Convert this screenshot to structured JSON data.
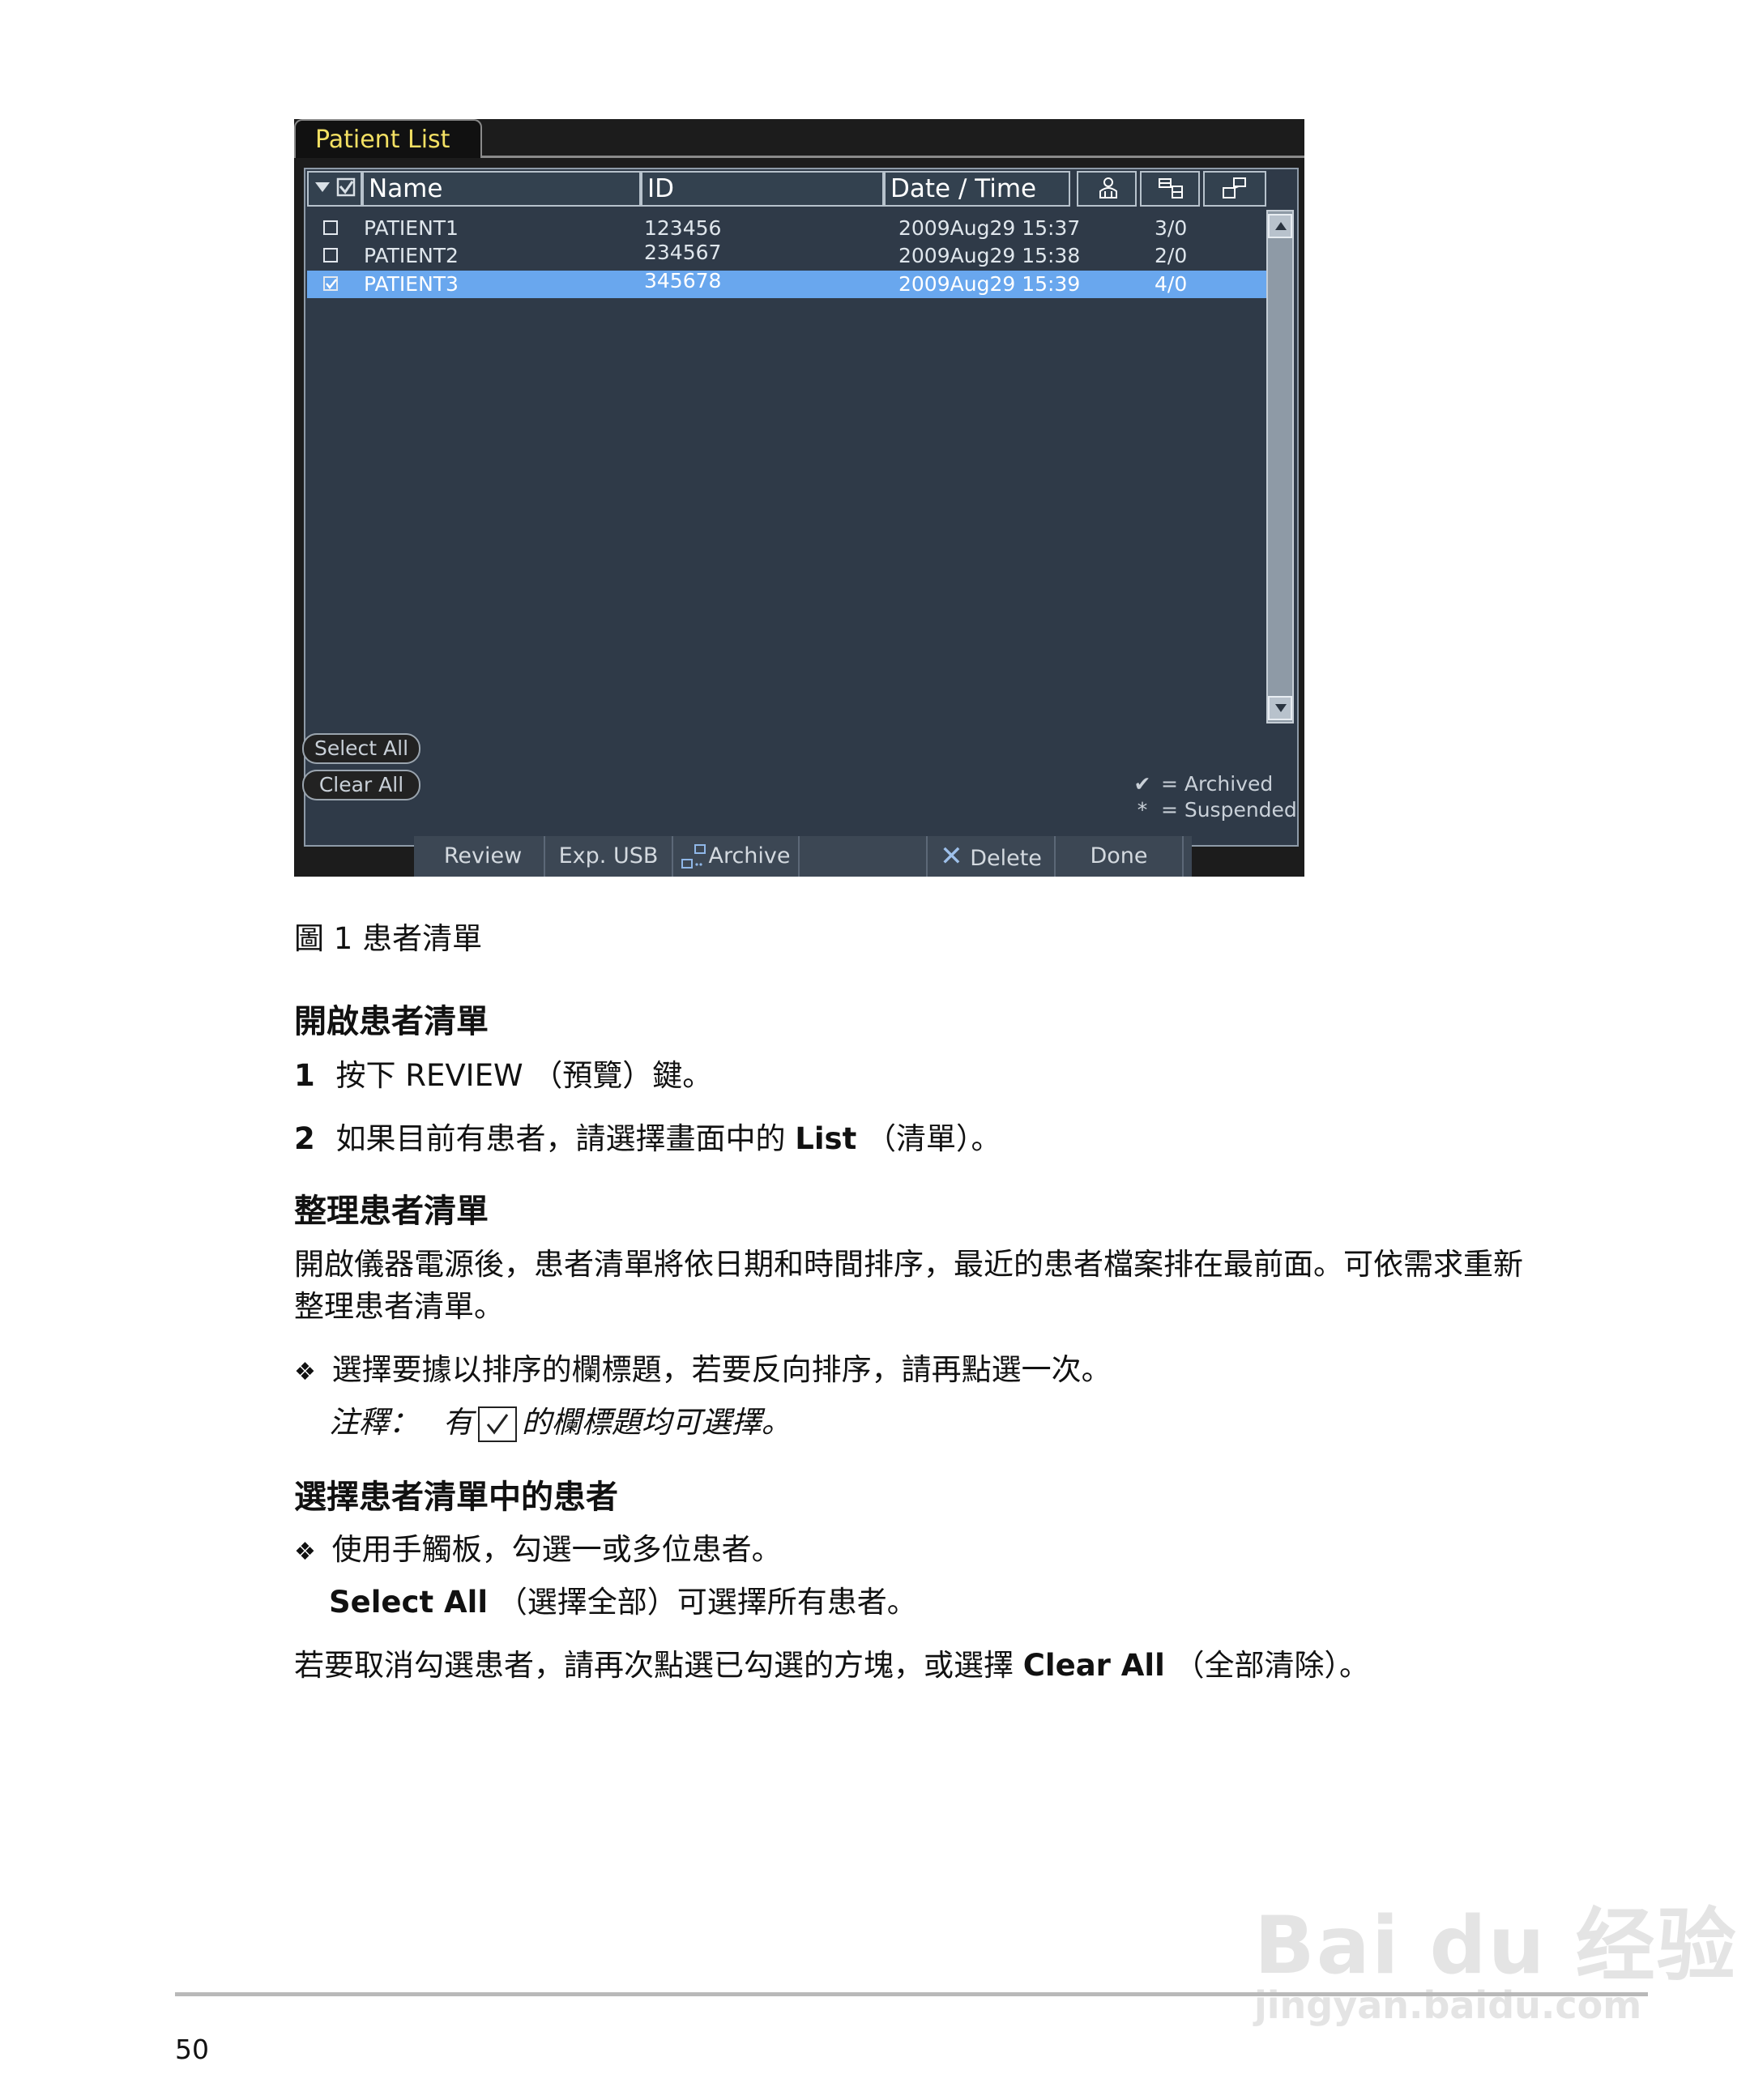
{
  "screen": {
    "tab_title": "Patient List",
    "columns": {
      "name": "Name",
      "id": "ID",
      "date_time": "Date / Time"
    },
    "column_icons": [
      "patient-icon",
      "exam-icon",
      "archive-column-icon"
    ],
    "rows": [
      {
        "checked": false,
        "name": "PATIENT1",
        "id": "123456",
        "date": "2009Aug29  15:37",
        "count": "3/0",
        "selected": false
      },
      {
        "checked": false,
        "name": "PATIENT2",
        "id": "234567",
        "date": "2009Aug29  15:38",
        "count": "2/0",
        "selected": false
      },
      {
        "checked": true,
        "name": "PATIENT3",
        "id": "345678",
        "date": "2009Aug29  15:39",
        "count": "4/0",
        "selected": true
      }
    ],
    "select_all": "Select All",
    "clear_all": "Clear All",
    "legend": {
      "archived": "= Archived",
      "suspended": "= Suspended"
    },
    "buttons": {
      "review": "Review",
      "exp_usb": "Exp. USB",
      "archive": "Archive",
      "delete": "Delete",
      "done": "Done"
    },
    "colors": {
      "selected_row": "#69a7ee",
      "tab_title": "#f3e063",
      "panel": "#2f3a48"
    }
  },
  "doc": {
    "caption": "圖 1  患者清單",
    "sec1_title": "開啟患者清單",
    "step1_num": "1",
    "step1_text": "按下 REVIEW （預覽）鍵。",
    "step2_num": "2",
    "step2_pre": "如果目前有患者，請選擇畫面中的 ",
    "step2_bold": "List",
    "step2_post": " （清單）。",
    "sec2_title": "整理患者清單",
    "sec2_para_line1": "開啟儀器電源後，患者清單將依日期和時間排序，最近的患者檔案排在最前面。可依需求重新",
    "sec2_para_line2": "整理患者清單。",
    "bullet1": "選擇要據以排序的欄標題，若要反向排序，請再點選一次。",
    "note_label": "注釋：",
    "note_pre": "有",
    "note_post": "的欄標題均可選擇。",
    "sec3_title": "選擇患者清單中的患者",
    "bullet2": "使用手觸板，勾選一或多位患者。",
    "select_all_bold": "Select All",
    "select_all_post": " （選擇全部）可選擇所有患者。",
    "clear_pre": "若要取消勾選患者，請再次點選已勾選的方塊，或選擇 ",
    "clear_bold": "Clear All",
    "clear_post": " （全部清除）。",
    "page_number": "50"
  },
  "watermark": {
    "logo": "Bai du 经验",
    "url": "jingyan.baidu.com"
  }
}
